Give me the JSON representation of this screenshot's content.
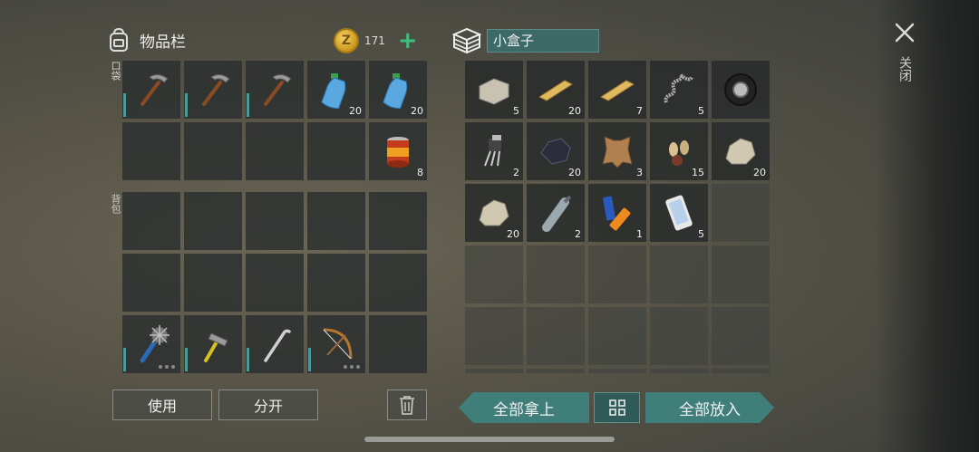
{
  "inventory": {
    "title": "物品栏",
    "coins": "171",
    "coin_icon_letter": "Z",
    "pocket_label": "口袋",
    "backpack_label": "背包",
    "pocket_slots": [
      {
        "icon": "pickaxe-icon",
        "qty": ""
      },
      {
        "icon": "pickaxe-icon",
        "qty": ""
      },
      {
        "icon": "pickaxe-icon",
        "qty": ""
      },
      {
        "icon": "water-bottle-icon",
        "qty": "20"
      },
      {
        "icon": "water-bottle-icon",
        "qty": "20"
      },
      {
        "icon": "",
        "qty": ""
      },
      {
        "icon": "",
        "qty": ""
      },
      {
        "icon": "",
        "qty": ""
      },
      {
        "icon": "",
        "qty": ""
      },
      {
        "icon": "canned-food-icon",
        "qty": "8"
      }
    ],
    "backpack_slots": [
      {
        "icon": "",
        "qty": ""
      },
      {
        "icon": "",
        "qty": ""
      },
      {
        "icon": "",
        "qty": ""
      },
      {
        "icon": "",
        "qty": ""
      },
      {
        "icon": "",
        "qty": ""
      },
      {
        "icon": "",
        "qty": ""
      },
      {
        "icon": "",
        "qty": ""
      },
      {
        "icon": "",
        "qty": ""
      },
      {
        "icon": "",
        "qty": ""
      },
      {
        "icon": "",
        "qty": ""
      },
      {
        "icon": "spiked-club-icon",
        "qty": ""
      },
      {
        "icon": "hammer-icon",
        "qty": ""
      },
      {
        "icon": "crowbar-icon",
        "qty": ""
      },
      {
        "icon": "bow-icon",
        "qty": ""
      },
      {
        "icon": "",
        "qty": ""
      }
    ]
  },
  "container": {
    "name": "小盒子",
    "slots": [
      {
        "icon": "stone-block-icon",
        "qty": "5"
      },
      {
        "icon": "wood-plank-icon",
        "qty": "20"
      },
      {
        "icon": "wood-plank-icon",
        "qty": "7"
      },
      {
        "icon": "spring-icon",
        "qty": "5"
      },
      {
        "icon": "tire-icon",
        "qty": ""
      },
      {
        "icon": "transistor-icon",
        "qty": "2"
      },
      {
        "icon": "coal-icon",
        "qty": "20"
      },
      {
        "icon": "leather-icon",
        "qty": "3"
      },
      {
        "icon": "seeds-icon",
        "qty": "15"
      },
      {
        "icon": "rock-icon",
        "qty": "20"
      },
      {
        "icon": "rock-icon",
        "qty": "20"
      },
      {
        "icon": "empty-bottle-icon",
        "qty": "2"
      },
      {
        "icon": "batteries-icon",
        "qty": "1"
      },
      {
        "icon": "smartphone-icon",
        "qty": "5"
      },
      {
        "icon": "",
        "qty": ""
      }
    ]
  },
  "buttons": {
    "use": "使用",
    "split": "分开",
    "take_all": "全部拿上",
    "put_all": "全部放入",
    "close": "关闭"
  },
  "colors": {
    "accent": "#3f7e79",
    "coin": "#c99718",
    "plus": "#3cc07a"
  }
}
